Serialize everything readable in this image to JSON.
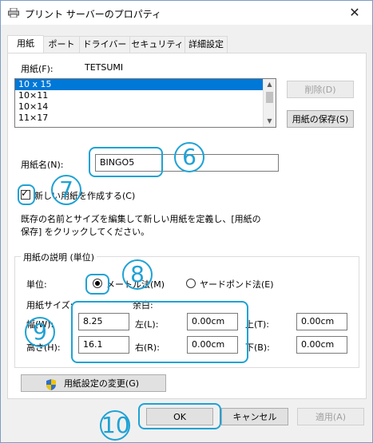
{
  "window": {
    "title": "プリント サーバーのプロパティ",
    "close_glyph": "✕"
  },
  "tabs": [
    {
      "label": "用紙"
    },
    {
      "label": "ポート"
    },
    {
      "label": "ドライバー"
    },
    {
      "label": "セキュリティ"
    },
    {
      "label": "詳細設定"
    }
  ],
  "paper": {
    "label": "用紙(F):",
    "printer_name": "TETSUMI",
    "list_items": [
      "10 x 15",
      "10×11",
      "10×14",
      "11×17"
    ],
    "selected_item": "10 x 15",
    "delete_button": "削除(D)",
    "save_button": "用紙の保存(S)",
    "name_label": "用紙名(N):",
    "name_value": "BINGO5",
    "create_new_label": "新しい用紙を作成する(C)",
    "create_new_checked": true,
    "help_text_line1": "既存の名前とサイズを編集して新しい用紙を定義し、[用紙の",
    "help_text_line2": "保存] をクリックしてください。"
  },
  "description_group": {
    "title": "用紙の説明 (単位)",
    "unit_label": "単位:",
    "metric_label": "メートル法(M)",
    "imperial_label": "ヤードポンド法(E)",
    "selected_unit": "metric",
    "paper_size_label": "用紙サイズ:",
    "margin_label": "余白:",
    "width_label": "幅(W):",
    "width_value": "8.25",
    "height_label": "高さ(H):",
    "height_value": "16.1",
    "left_label": "左(L):",
    "left_value": "0.00cm",
    "right_label": "右(R):",
    "right_value": "0.00cm",
    "top_label": "上(T):",
    "top_value": "0.00cm",
    "bottom_label": "下(B):",
    "bottom_value": "0.00cm"
  },
  "change_settings_button": "用紙設定の変更(G)",
  "footer": {
    "ok": "OK",
    "cancel": "キャンセル",
    "apply": "適用(A)"
  },
  "annotations": [
    "6",
    "7",
    "8",
    "9",
    "10"
  ],
  "colors": {
    "annotation": "#1fa2d4",
    "selection": "#0078d7"
  },
  "icons": [
    "printer-icon",
    "close-icon",
    "shield-icon"
  ]
}
